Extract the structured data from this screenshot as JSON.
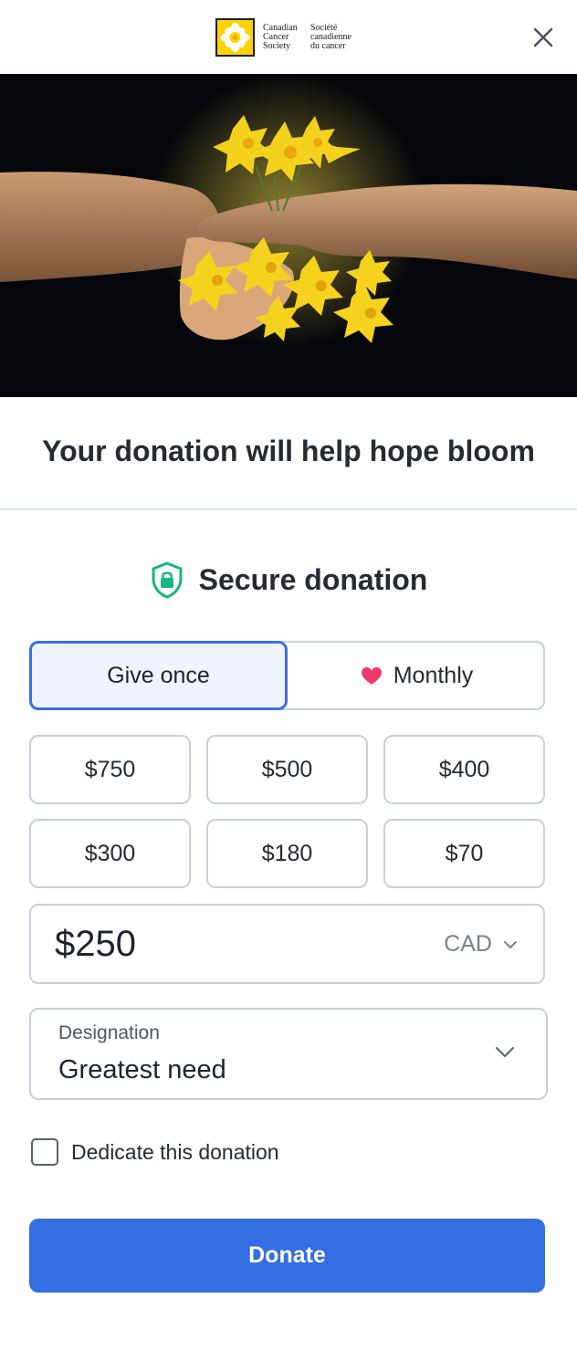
{
  "header": {
    "logo_en_lines": [
      "Canadian",
      "Cancer",
      "Society"
    ],
    "logo_fr_lines": [
      "Société",
      "canadienne",
      "du cancer"
    ],
    "close_icon": "close-icon"
  },
  "hero": {
    "image": "hands-holding-daffodils"
  },
  "title": "Your donation will help hope bloom",
  "secure": {
    "label": "Secure donation",
    "icon": "shield-lock-icon",
    "icon_color": "#17b583"
  },
  "frequency": {
    "once_label": "Give once",
    "monthly_label": "Monthly",
    "selected": "Give once",
    "heart_color": "#ef3b6a"
  },
  "amounts": [
    "$750",
    "$500",
    "$400",
    "$300",
    "$180",
    "$70"
  ],
  "custom_amount": {
    "value": "$250",
    "currency": "CAD"
  },
  "designation": {
    "label": "Designation",
    "value": "Greatest need"
  },
  "dedicate": {
    "label": "Dedicate this donation",
    "checked": false
  },
  "donate_button": {
    "label": "Donate",
    "color": "#336fe2"
  }
}
